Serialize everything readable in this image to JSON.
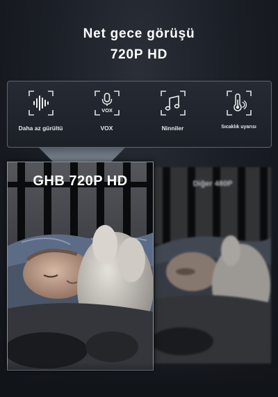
{
  "header": {
    "line1": "Net gece görüşü",
    "line2": "720P HD"
  },
  "features": [
    {
      "label": "Daha az gürültü",
      "icon": "sound-wave-icon"
    },
    {
      "label": "VOX",
      "icon": "microphone-vox-icon",
      "icon_text": "VOX"
    },
    {
      "label": "Ninniler",
      "icon": "music-note-icon"
    },
    {
      "label": "Sıcaklık uyarısı",
      "icon": "thermometer-icon"
    }
  ],
  "comparison": {
    "left_title": "GHB 720P HD",
    "right_title": "Diğer 480P"
  },
  "colors": {
    "accent_panel_border": "#5d6673",
    "background": "#15181e",
    "text": "#ffffff"
  }
}
